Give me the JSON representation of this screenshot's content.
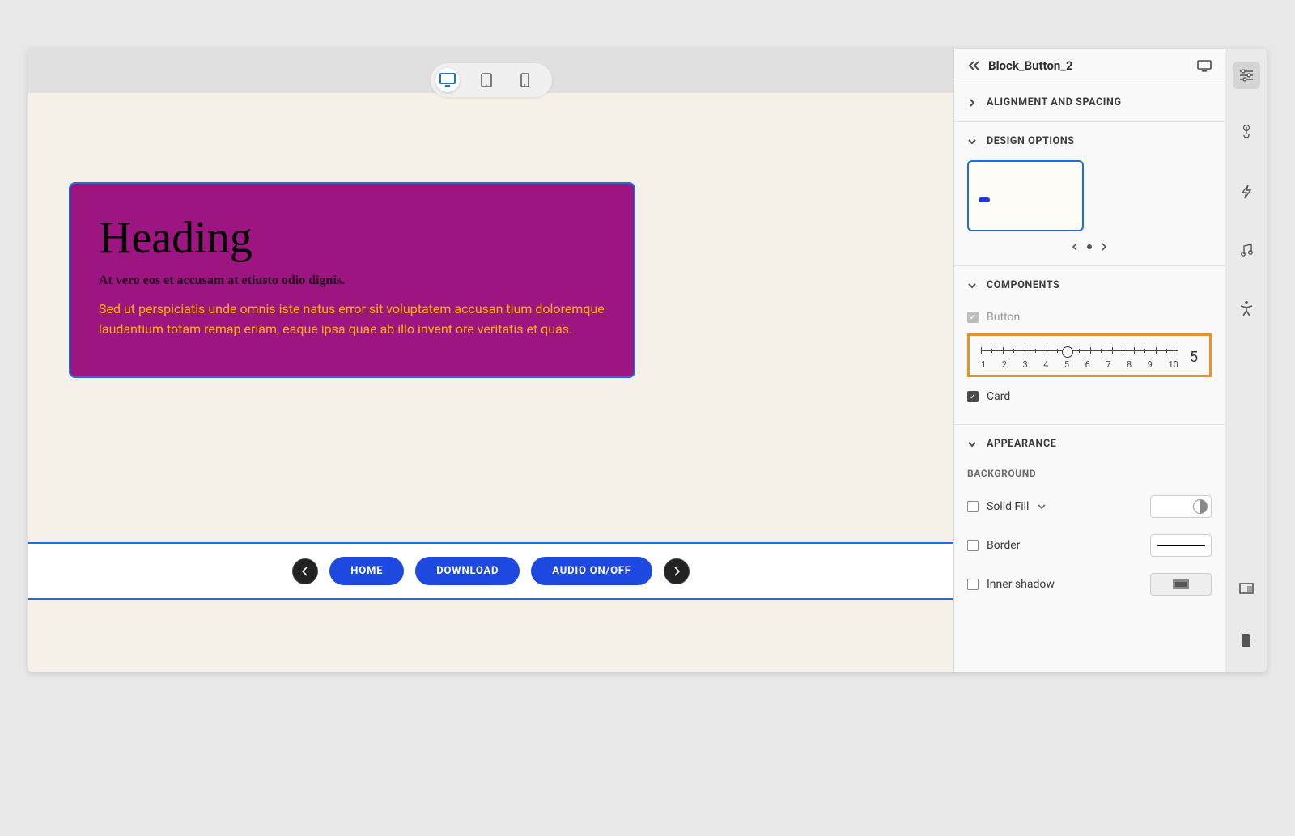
{
  "panel": {
    "title": "Block_Button_2",
    "sections": {
      "alignment": "ALIGNMENT AND SPACING",
      "design": "DESIGN OPTIONS",
      "components": "COMPONENTS",
      "appearance": "APPEARANCE"
    },
    "components": {
      "button": {
        "label": "Button",
        "checked": true,
        "slider_value": "5",
        "ticks": [
          "1",
          "2",
          "3",
          "4",
          "5",
          "6",
          "7",
          "8",
          "9",
          "10"
        ]
      },
      "card": {
        "label": "Card",
        "checked": true
      }
    },
    "appearance": {
      "sublabel": "BACKGROUND",
      "solid_fill": "Solid Fill",
      "border": "Border",
      "inner_shadow": "Inner shadow"
    }
  },
  "canvas": {
    "heading": "Heading",
    "subheading": "At vero eos et accusam at etiusto odio dignis.",
    "body": "Sed ut perspiciatis unde omnis iste natus error sit voluptatem accusan tium doloremque laudantium totam remap eriam, eaque ipsa quae ab illo invent ore veritatis et quas.",
    "buttons": [
      "HOME",
      "DOWNLOAD",
      "AUDIO ON/OFF"
    ]
  }
}
